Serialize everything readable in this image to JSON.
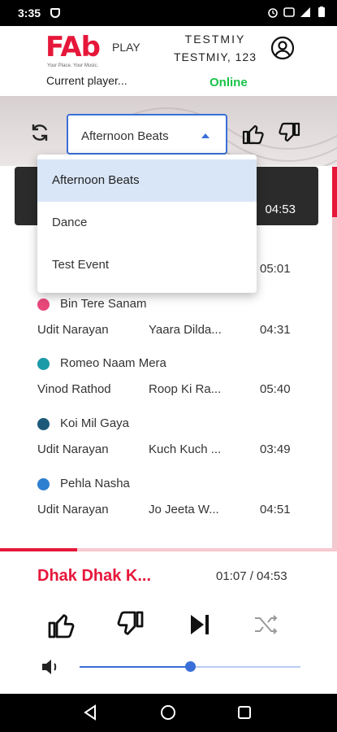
{
  "status_bar": {
    "time": "3:35"
  },
  "header": {
    "logo_text": "FAb",
    "logo_suffix": "PLAY",
    "logo_tagline": "Your Place. Your Music.",
    "current_player": "Current player...",
    "user_name": "TESTMIY",
    "user_detail": "TESTMIY, 123",
    "status": "Online"
  },
  "playlist_select": {
    "value": "Afternoon Beats",
    "options": [
      "Afternoon Beats",
      "Dance",
      "Test Event"
    ],
    "selected_index": 0
  },
  "now_playing_card": {
    "duration": "04:53"
  },
  "partial_row": {
    "duration": "05:01"
  },
  "songs": [
    {
      "title": "Bin Tere Sanam",
      "artist": "Udit Narayan",
      "album": "Yaara Dilda...",
      "duration": "04:31",
      "dot_color": "#e8487a"
    },
    {
      "title": "Romeo Naam Mera",
      "artist": "Vinod Rathod",
      "album": "Roop Ki Ra...",
      "duration": "05:40",
      "dot_color": "#1b9aa8"
    },
    {
      "title": "Koi Mil Gaya",
      "artist": "Udit Narayan",
      "album": "Kuch Kuch ...",
      "duration": "03:49",
      "dot_color": "#1d5a7a"
    },
    {
      "title": "Pehla Nasha",
      "artist": "Udit Narayan",
      "album": "Jo Jeeta W...",
      "duration": "04:51",
      "dot_color": "#2f7fd0"
    }
  ],
  "player": {
    "title": "Dhak Dhak K...",
    "time": "01:07 / 04:53",
    "progress_fraction": 0.23,
    "volume_fraction": 0.5
  },
  "colors": {
    "accent": "#e6173a",
    "online": "#19c34a",
    "selection": "#3a6fd8"
  },
  "icons": {
    "sync": "sync-icon",
    "like": "thumbs-up-icon",
    "dislike": "thumbs-down-icon",
    "next": "skip-next-icon",
    "shuffle": "shuffle-icon",
    "volume": "volume-icon",
    "avatar": "account-circle-icon"
  }
}
